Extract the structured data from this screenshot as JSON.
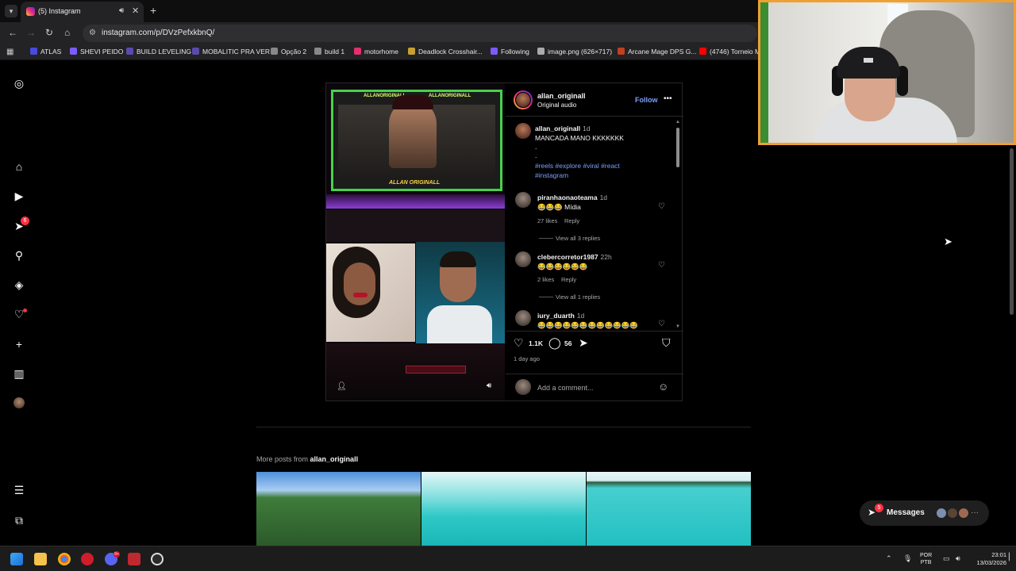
{
  "browser": {
    "tab": {
      "title": "(5) Instagram"
    },
    "address": {
      "url": "instagram.com/p/DVzPefxkbnQ/"
    },
    "bookmarks": [
      {
        "label": "ATLAS",
        "color": "#4a4ae0"
      },
      {
        "label": "SHEVI PEIDO",
        "color": "#7c5cff"
      },
      {
        "label": "BUILD LEVELING",
        "color": "#5a4ab0"
      },
      {
        "label": "MOBALITIC PRA VER",
        "color": "#5a4ab0"
      },
      {
        "label": "Opção 2",
        "color": "#888888"
      },
      {
        "label": "build 1",
        "color": "#888888"
      },
      {
        "label": "motorhome",
        "color": "#e1306c"
      },
      {
        "label": "Deadlock Crosshair...",
        "color": "#c8a030"
      },
      {
        "label": "Following",
        "color": "#7c5cff"
      },
      {
        "label": "image.png (626×717)",
        "color": "#aaaaaa"
      },
      {
        "label": "Arcane Mage DPS G...",
        "color": "#c04020"
      },
      {
        "label": "(4746) Torneio M...",
        "color": "#ff0000"
      }
    ]
  },
  "sidebar": {
    "notification_count": "6"
  },
  "post": {
    "author": "allan_originall",
    "audio": "Original audio",
    "follow_label": "Follow",
    "stream_tag_left": "ALLANORIGINALL",
    "stream_tag_right": "ALLANORIGINALL",
    "stream_name": "ALLAN ORIGINALL",
    "caption": {
      "user": "allan_originall",
      "time": "1d",
      "text": "MANCADA MANO KKKKKKK",
      "dot1": ".",
      "dot2": ".",
      "tags_line1": "#reels #explore #viral #react",
      "tags_line2": "#instagram"
    },
    "comments": [
      {
        "user": "piranhaonaoteama",
        "time": "1d",
        "text": "😂😂😂 Mídia",
        "likes": "27 likes",
        "reply": "Reply",
        "view_replies": "View all 3 replies"
      },
      {
        "user": "clebercorretor1987",
        "time": "22h",
        "text": "😂😂😂😂😂😂",
        "likes": "2 likes",
        "reply": "Reply",
        "view_replies": "View all 1 replies"
      },
      {
        "user": "iury_duarth",
        "time": "1d",
        "text": "😂😂😂😂😂😂😂😂😂😂😂😂"
      }
    ],
    "like_count": "1.1K",
    "comment_count": "56",
    "posted_ago": "1 day ago",
    "add_comment_placeholder": "Add a comment..."
  },
  "more_posts": {
    "prefix": "More posts from",
    "author": "allan_originall"
  },
  "messages": {
    "label": "Messages",
    "badge": "5"
  },
  "taskbar": {
    "lang_top": "POR",
    "lang_bottom": "PTB",
    "time": "23:01",
    "date": "13/03/2026",
    "discord_badge": "9+"
  }
}
